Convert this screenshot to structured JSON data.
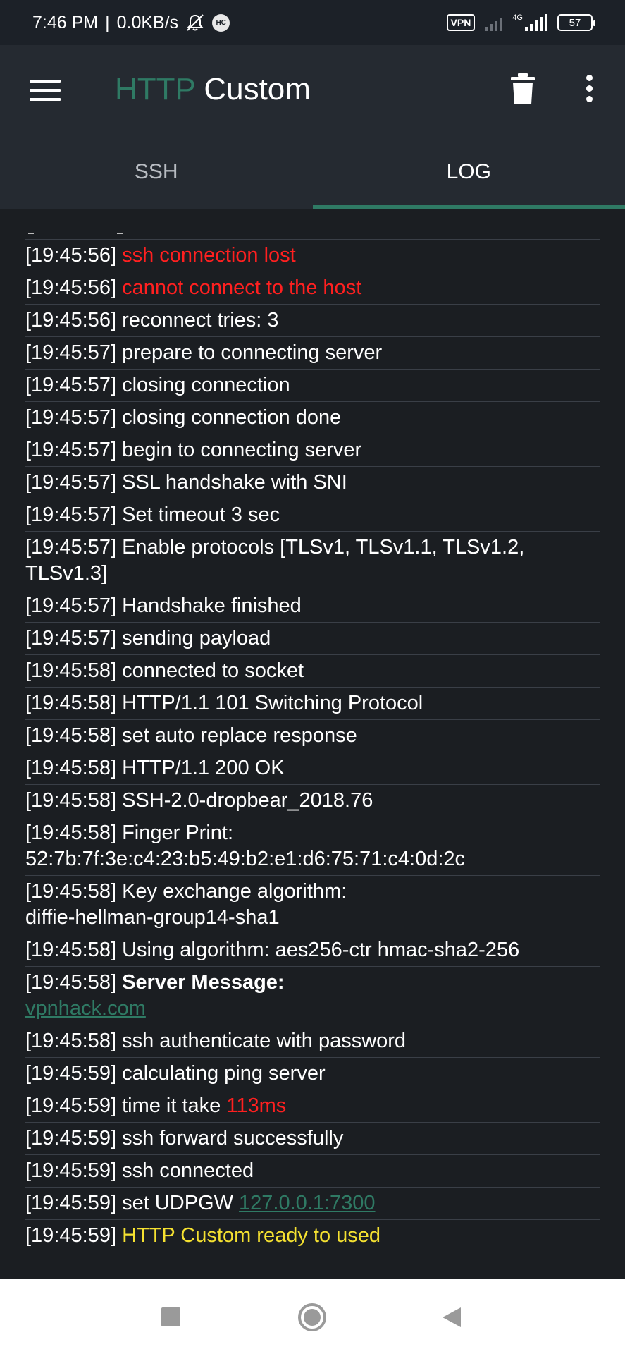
{
  "status_bar": {
    "time": "7:46 PM",
    "separator": "|",
    "speed": "0.0KB/s",
    "hc_badge": "HC",
    "vpn_label": "VPN",
    "network_type": "4G",
    "battery": "57"
  },
  "app_bar": {
    "title_part1": "HTTP",
    "title_part2": "Custom"
  },
  "tabs": [
    {
      "label": "SSH",
      "active": false
    },
    {
      "label": "LOG",
      "active": true
    }
  ],
  "log": [
    {
      "time": "[19:45:56]",
      "segments": [
        {
          "text": "ssh connection lost",
          "style": "red"
        }
      ]
    },
    {
      "time": "[19:45:56]",
      "segments": [
        {
          "text": "cannot connect to the host",
          "style": "red"
        }
      ]
    },
    {
      "time": "[19:45:56]",
      "segments": [
        {
          "text": "reconnect tries: 3",
          "style": "normal"
        }
      ]
    },
    {
      "time": "[19:45:57]",
      "segments": [
        {
          "text": "prepare to connecting server",
          "style": "normal"
        }
      ]
    },
    {
      "time": "[19:45:57]",
      "segments": [
        {
          "text": "closing connection",
          "style": "normal"
        }
      ]
    },
    {
      "time": "[19:45:57]",
      "segments": [
        {
          "text": "closing connection done",
          "style": "normal"
        }
      ]
    },
    {
      "time": "[19:45:57]",
      "segments": [
        {
          "text": "begin to connecting server",
          "style": "normal"
        }
      ]
    },
    {
      "time": "[19:45:57]",
      "segments": [
        {
          "text": "SSL handshake with SNI",
          "style": "normal"
        }
      ]
    },
    {
      "time": "[19:45:57]",
      "segments": [
        {
          "text": "Set timeout 3 sec",
          "style": "normal"
        }
      ]
    },
    {
      "time": "[19:45:57]",
      "segments": [
        {
          "text": "Enable protocols [TLSv1, TLSv1.1, TLSv1.2, TLSv1.3]",
          "style": "normal"
        }
      ]
    },
    {
      "time": "[19:45:57]",
      "segments": [
        {
          "text": "Handshake finished",
          "style": "normal"
        }
      ]
    },
    {
      "time": "[19:45:57]",
      "segments": [
        {
          "text": "sending payload",
          "style": "normal"
        }
      ]
    },
    {
      "time": "[19:45:58]",
      "segments": [
        {
          "text": "connected to socket",
          "style": "normal"
        }
      ]
    },
    {
      "time": "[19:45:58]",
      "segments": [
        {
          "text": "HTTP/1.1 101 Switching Protocol",
          "style": "normal"
        }
      ]
    },
    {
      "time": "[19:45:58]",
      "segments": [
        {
          "text": "set auto replace response",
          "style": "normal"
        }
      ]
    },
    {
      "time": "[19:45:58]",
      "segments": [
        {
          "text": "HTTP/1.1 200 OK",
          "style": "normal"
        }
      ]
    },
    {
      "time": "[19:45:58]",
      "segments": [
        {
          "text": "SSH-2.0-dropbear_2018.76",
          "style": "normal"
        }
      ]
    },
    {
      "time": "[19:45:58]",
      "segments": [
        {
          "text": "Finger Print:\n52:7b:7f:3e:c4:23:b5:49:b2:e1:d6:75:71:c4:0d:2c",
          "style": "normal"
        }
      ]
    },
    {
      "time": "[19:45:58]",
      "segments": [
        {
          "text": "Key exchange algorithm:\ndiffie-hellman-group14-sha1",
          "style": "normal"
        }
      ]
    },
    {
      "time": "[19:45:58]",
      "segments": [
        {
          "text": "Using algorithm: aes256-ctr hmac-sha2-256",
          "style": "normal"
        }
      ]
    },
    {
      "time": "[19:45:58]",
      "segments": [
        {
          "text": "Server Message:",
          "style": "bold"
        },
        {
          "text": "\n",
          "style": "normal"
        },
        {
          "text": "vpnhack.com",
          "style": "link"
        }
      ]
    },
    {
      "time": "[19:45:58]",
      "segments": [
        {
          "text": "ssh authenticate with password",
          "style": "normal"
        }
      ]
    },
    {
      "time": "[19:45:59]",
      "segments": [
        {
          "text": "calculating ping server",
          "style": "normal"
        }
      ]
    },
    {
      "time": "[19:45:59]",
      "segments": [
        {
          "text": "time it take ",
          "style": "normal"
        },
        {
          "text": "113ms",
          "style": "red"
        }
      ]
    },
    {
      "time": "[19:45:59]",
      "segments": [
        {
          "text": "ssh forward successfully",
          "style": "normal"
        }
      ]
    },
    {
      "time": "[19:45:59]",
      "segments": [
        {
          "text": "ssh connected",
          "style": "normal"
        }
      ]
    },
    {
      "time": "[19:45:59]",
      "segments": [
        {
          "text": "set UDPGW ",
          "style": "normal"
        },
        {
          "text": "127.0.0.1:7300",
          "style": "link"
        }
      ]
    },
    {
      "time": "[19:45:59]",
      "segments": [
        {
          "text": "HTTP Custom ready to used",
          "style": "yellow"
        }
      ]
    }
  ],
  "colors": {
    "accent": "#2f7a64",
    "error": "#ff2020",
    "success": "#f5e131",
    "background": "#1b1e22",
    "toolbar": "#252a31"
  },
  "icons": {
    "menu": "hamburger-icon",
    "delete": "trash-icon",
    "more": "more-vert-icon",
    "nav_recent": "square-icon",
    "nav_home": "circle-icon",
    "nav_back": "triangle-back-icon"
  }
}
